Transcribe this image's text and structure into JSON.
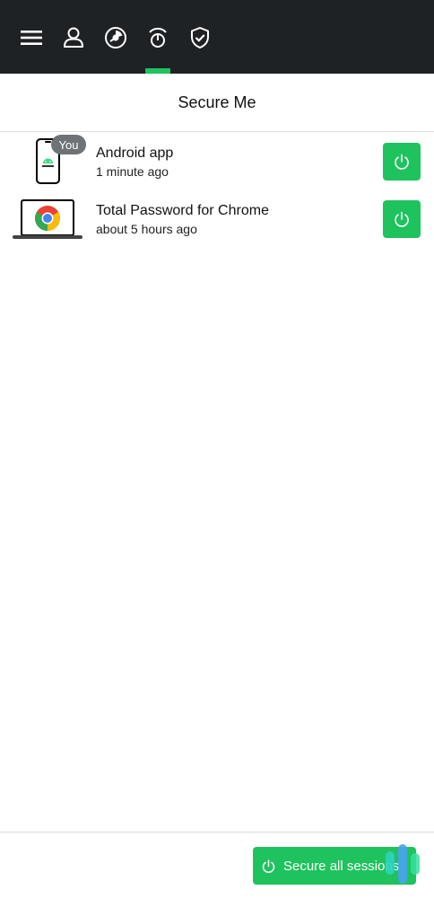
{
  "topbar": {
    "icons": [
      "menu-icon",
      "user-icon",
      "dashboard-icon",
      "secure-me-icon",
      "shield-check-icon"
    ],
    "active_index": 3,
    "accent_color": "#1ec35d",
    "background": "#1f2225"
  },
  "header": {
    "title": "Secure Me"
  },
  "sessions": [
    {
      "name": "Android app",
      "time": "1 minute ago",
      "badge": "You",
      "device_icon": "android-phone-icon",
      "action_icon": "power-icon"
    },
    {
      "name": "Total Password for Chrome",
      "time": "about 5 hours ago",
      "device_icon": "chrome-laptop-icon",
      "action_icon": "power-icon"
    }
  ],
  "footer": {
    "secure_all_label": "Secure all sessions"
  }
}
